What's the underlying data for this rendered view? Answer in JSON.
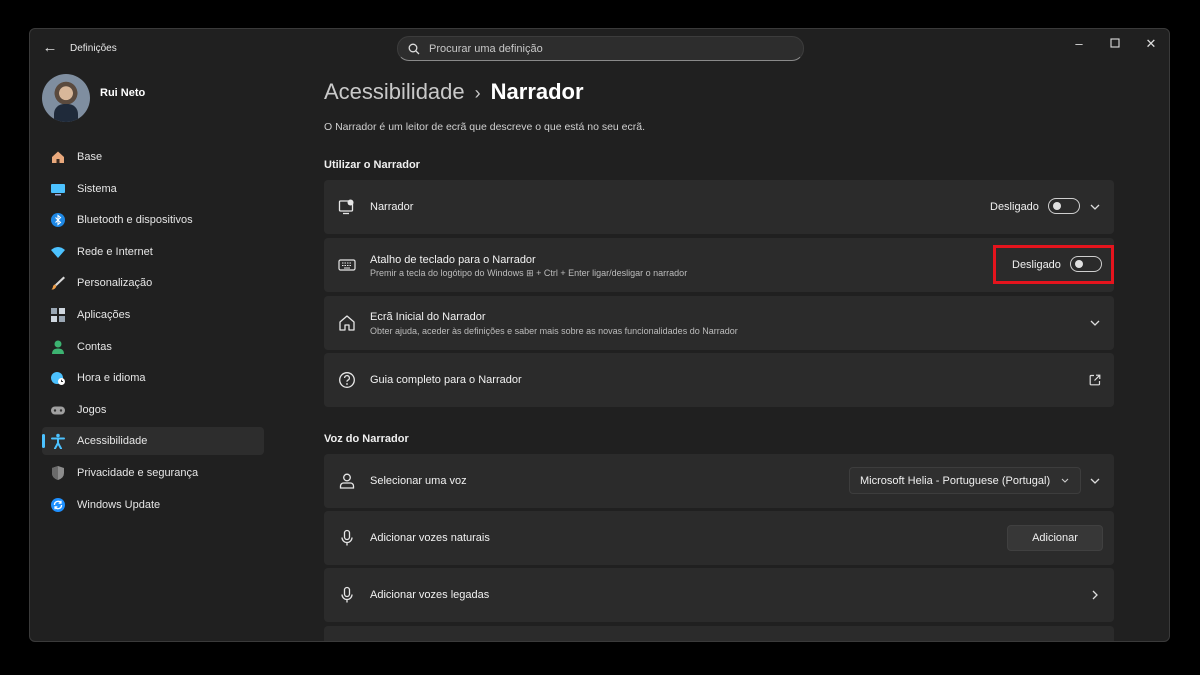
{
  "window": {
    "title": "Definições",
    "search_placeholder": "Procurar uma definição"
  },
  "profile": {
    "name": "Rui Neto"
  },
  "nav": [
    {
      "label": "Base",
      "icon": "home-icon",
      "color": "#e8a87c"
    },
    {
      "label": "Sistema",
      "icon": "monitor-icon",
      "color": "#4cc2ff"
    },
    {
      "label": "Bluetooth e dispositivos",
      "icon": "bluetooth-icon",
      "color": "#1e88e5"
    },
    {
      "label": "Rede e Internet",
      "icon": "wifi-icon",
      "color": "#4cc2ff"
    },
    {
      "label": "Personalização",
      "icon": "brush-icon",
      "color": "#f0a04b"
    },
    {
      "label": "Aplicações",
      "icon": "apps-icon",
      "color": "#9aa7b4"
    },
    {
      "label": "Contas",
      "icon": "person-icon",
      "color": "#3cb371"
    },
    {
      "label": "Hora e idioma",
      "icon": "globe-clock-icon",
      "color": "#4cc2ff"
    },
    {
      "label": "Jogos",
      "icon": "gamepad-icon",
      "color": "#a0a0a0"
    },
    {
      "label": "Acessibilidade",
      "icon": "accessibility-icon",
      "color": "#4cc2ff",
      "active": true
    },
    {
      "label": "Privacidade e segurança",
      "icon": "shield-icon",
      "color": "#8c8c8c"
    },
    {
      "label": "Windows Update",
      "icon": "update-icon",
      "color": "#1e90ff"
    }
  ],
  "page": {
    "breadcrumb_parent": "Acessibilidade",
    "breadcrumb_separator": "›",
    "breadcrumb_current": "Narrador",
    "description": "O Narrador é um leitor de ecrã que descreve o que está no seu ecrã."
  },
  "sections": {
    "use": "Utilizar o Narrador",
    "voice": "Voz do Narrador"
  },
  "cards": {
    "narrador": {
      "title": "Narrador",
      "state": "Desligado"
    },
    "shortcut": {
      "title": "Atalho de teclado para o Narrador",
      "subtitle": "Premir a tecla do logótipo do Windows ⊞ + Ctrl + Enter ligar/desligar o narrador",
      "state": "Desligado"
    },
    "home": {
      "title": "Ecrã Inicial do Narrador",
      "subtitle": "Obter ajuda, aceder às definições e saber mais sobre as novas funcionalidades do Narrador"
    },
    "guide": {
      "title": "Guia completo para o Narrador"
    },
    "voice_select": {
      "title": "Selecionar uma voz",
      "value": "Microsoft Helia - Portuguese (Portugal)"
    },
    "natural": {
      "title": "Adicionar vozes naturais",
      "button": "Adicionar"
    },
    "legacy": {
      "title": "Adicionar vozes legadas"
    }
  },
  "colors": {
    "accent": "#4cc2ff",
    "highlight": "#e5141d"
  }
}
